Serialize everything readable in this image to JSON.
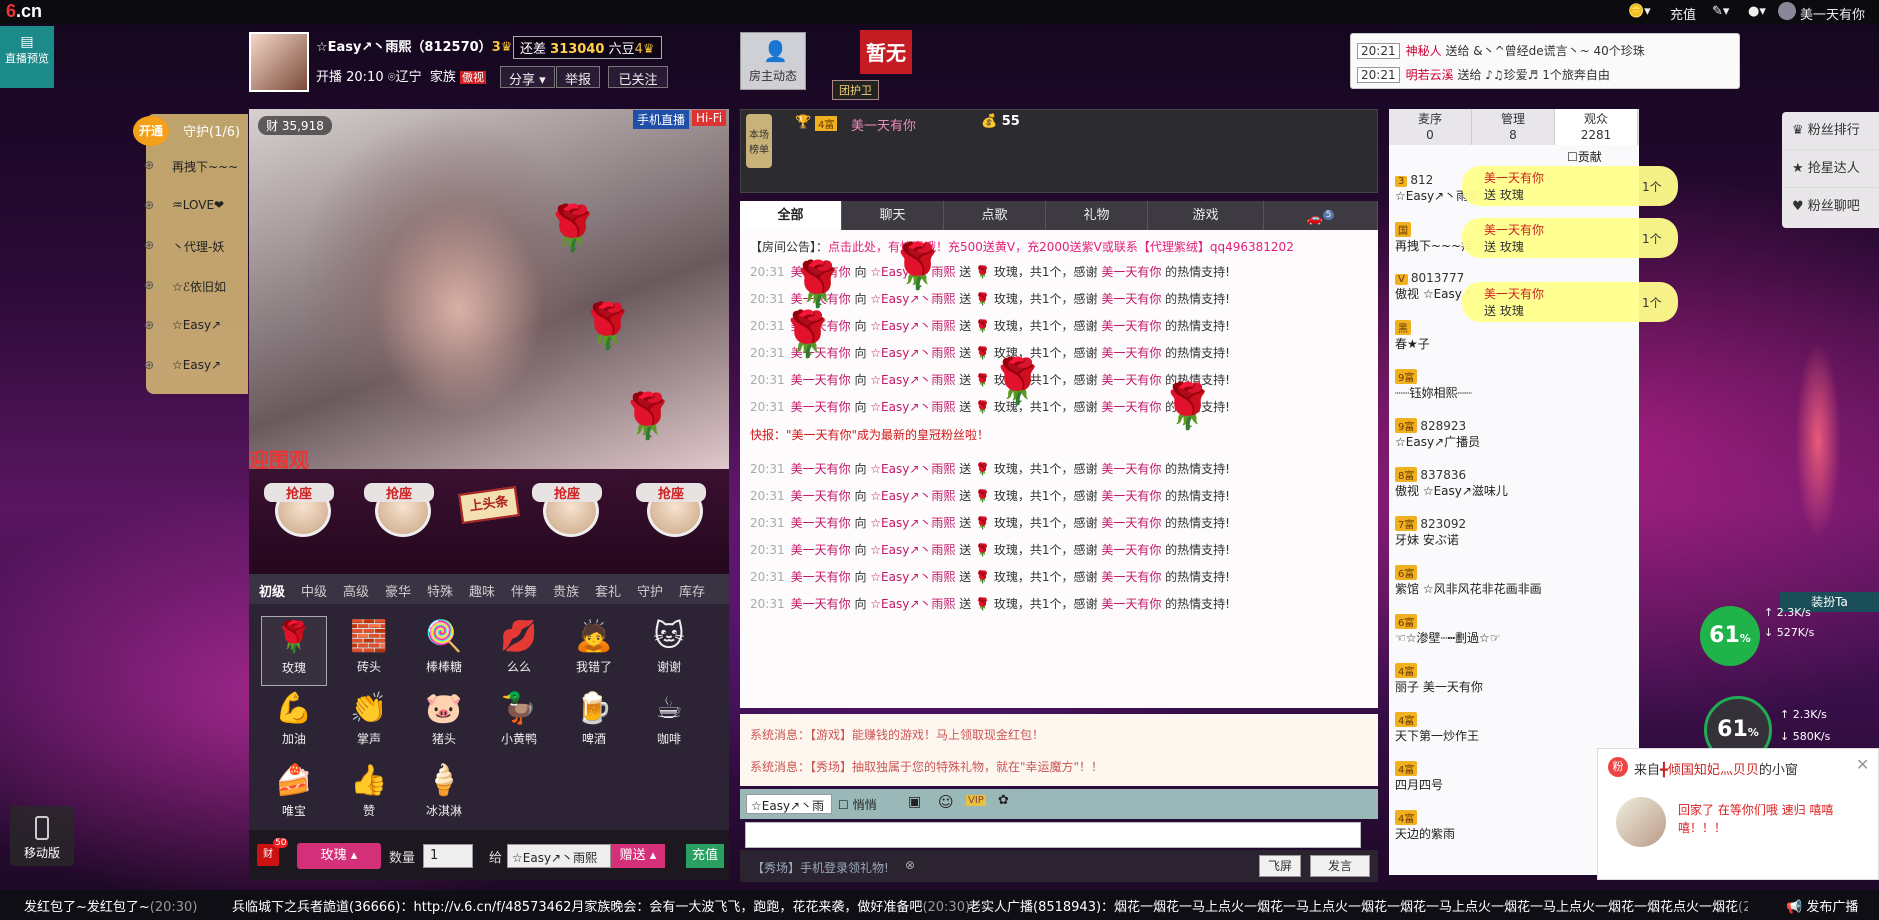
{
  "topbar": {
    "logo": "6.cn",
    "recharge": "充值",
    "username": "美一天有你"
  },
  "preview": {
    "label": "直播预览"
  },
  "host": {
    "name": "☆Easy↗丶雨熙（812570）",
    "level": "3",
    "beans_prefix": "还差",
    "beans": "313040",
    "beans_suffix": "六豆",
    "beans_level": "4",
    "open_time": "开播 20:10",
    "location": "辽宁",
    "family_label": "家族",
    "family": "傲视",
    "share": "分享",
    "report": "举报",
    "followed": "已关注"
  },
  "dynamics": {
    "label": "房主动态"
  },
  "guard_top": {
    "none": "暂无",
    "guard": "团护卫"
  },
  "ticker": [
    {
      "time": "20:21",
      "user": "神秘人",
      "text": "送给 &丶^曾经de谎言丶~ 40个珍珠"
    },
    {
      "time": "20:21",
      "user": "明若云溪",
      "text": "送给 ♪♫珍爱♬ 1个旅奔自由"
    }
  ],
  "guard_panel": {
    "open": "开通",
    "title": "守护(1/6)",
    "members": [
      "再拽下~~~",
      "♒LOVE❤",
      "丶代理-妖",
      "☆ℰ依旧如",
      "☆Easy↗",
      "☆Easy↗"
    ]
  },
  "video": {
    "viewers": "35,918",
    "mobile": "手机直播",
    "hifi": "Hi-Fi",
    "welcome": "迎围观"
  },
  "seats": {
    "grab": "抢座",
    "headline": "上头条"
  },
  "gift_tabs": [
    "初级",
    "中级",
    "高级",
    "豪华",
    "特殊",
    "趣味",
    "伴舞",
    "贵族",
    "套礼",
    "守护",
    "库存"
  ],
  "gifts": [
    {
      "name": "玫瑰",
      "icon": "🌹"
    },
    {
      "name": "砖头",
      "icon": "🧱"
    },
    {
      "name": "棒棒糖",
      "icon": "🍭"
    },
    {
      "name": "么么",
      "icon": "💋"
    },
    {
      "name": "我错了",
      "icon": "🙇"
    },
    {
      "name": "谢谢",
      "icon": "🐱"
    },
    {
      "name": "加油",
      "icon": "💪"
    },
    {
      "name": "掌声",
      "icon": "👏"
    },
    {
      "name": "猪头",
      "icon": "🐷"
    },
    {
      "name": "小黄鸭",
      "icon": "🦆"
    },
    {
      "name": "啤酒",
      "icon": "🍺"
    },
    {
      "name": "咖啡",
      "icon": "☕"
    },
    {
      "name": "唯宝",
      "icon": "🍰"
    },
    {
      "name": "赞",
      "icon": "👍"
    },
    {
      "name": "冰淇淋",
      "icon": "🍦"
    }
  ],
  "send": {
    "count_badge": "50",
    "gift": "玫瑰",
    "qty_label": "数量",
    "qty": "1",
    "to_label": "给",
    "to": "☆Easy↗丶雨熙",
    "give": "赠送",
    "recharge": "充值"
  },
  "rank": {
    "label": "本场榜单",
    "level": "4富",
    "user": "美一天有你",
    "score": "55"
  },
  "chat_tabs": [
    "全部",
    "聊天",
    "点歌",
    "礼物",
    "游戏"
  ],
  "chat_tab_badge": "5",
  "chat": {
    "notice_prefix": "【房间公告】：",
    "notice": "点击此处，有惊喜哦！充500送黄V，充2000送紫V或联系【代理紫绒】qq496381202",
    "line": {
      "time": "20:31",
      "from": "美一天有你",
      "mid": "向",
      "to": "☆Easy↗丶雨熙",
      "send": "送",
      "gift": "玫瑰，共1个，感谢",
      "thanks_user": "美一天有你",
      "end": "的热情支持!"
    },
    "alert": "快报：\"美一天有你\"成为最新的皇冠粉丝啦！"
  },
  "system": [
    "系统消息：【游戏】能赚钱的游戏！马上领取现金红包！",
    "系统消息：【秀场】抽取独属于您的特殊礼物，就在\"幸运魔方\"！！"
  ],
  "input": {
    "target": "☆Easy↗丶雨",
    "whisper": "悄悄",
    "promo": "【秀场】手机登录领礼物!",
    "fly": "飞屏",
    "send": "发言"
  },
  "ulist_tabs": [
    {
      "label": "麦序",
      "count": "0"
    },
    {
      "label": "管理",
      "count": "8"
    },
    {
      "label": "观众",
      "count": "2281"
    }
  ],
  "contrib": "贡献",
  "users": [
    {
      "lv": "3",
      "name": "☆Easy↗丶雨熙",
      "id": "812"
    },
    {
      "lv": "国",
      "name": "再拽下~~~痒",
      "id": ""
    },
    {
      "lv": "V",
      "name": "傲视 ☆Easy↗",
      "id": "8013777"
    },
    {
      "lv": "黑",
      "name": "春★子",
      "id": ""
    },
    {
      "lv": "9富",
      "name": "┈┈钰妳相熙┈┈",
      "id": ""
    },
    {
      "lv": "9富",
      "name": "☆Easy↗广播员",
      "id": "828923"
    },
    {
      "lv": "8富",
      "name": "傲视 ☆Easy↗滋味儿",
      "id": "837836"
    },
    {
      "lv": "7富",
      "name": "牙妹 安ぶ诺",
      "id": "823092"
    },
    {
      "lv": "6富",
      "name": "紫馆 ☆风非风花非花画非画",
      "id": ""
    },
    {
      "lv": "6富",
      "name": "☜☆渗壁┄┅劃過☆☞",
      "id": ""
    },
    {
      "lv": "4富",
      "name": "丽子 美一天有你",
      "id": ""
    },
    {
      "lv": "4富",
      "name": "天下第一炒作王",
      "id": ""
    },
    {
      "lv": "4富",
      "name": "四月四号",
      "id": ""
    },
    {
      "lv": "4富",
      "name": "天边的紫雨",
      "id": ""
    }
  ],
  "float_notices": [
    {
      "user": "美一天有你",
      "text": "送 玫瑰",
      "count": "1个"
    },
    {
      "user": "美一天有你",
      "text": "送 玫瑰",
      "count": "1个"
    },
    {
      "user": "美一天有你",
      "text": "送 玫瑰",
      "count": "1个"
    }
  ],
  "right_menu": [
    "粉丝排行",
    "抢星达人",
    "粉丝聊吧"
  ],
  "dressup": "装扮Ta",
  "net": [
    {
      "pct": "61",
      "unit": "%",
      "up": "2.3K/s",
      "down": "527K/s"
    },
    {
      "pct": "61",
      "unit": "%",
      "up": "2.3K/s",
      "down": "580K/s"
    }
  ],
  "popup": {
    "from_prefix": "来自",
    "from": "╋倾国知妃灬贝贝",
    "from_suffix": "的小窗",
    "msg": "回家了 在等你们哦 速归 嘻嘻嘻！！！"
  },
  "mobile": "移动版",
  "bottom": {
    "left": "发红包了~发红包了~",
    "left_time": "(20:30)",
    "mid": "兵临城下之兵者詭道(36666)：http://v.6.cn/f/48573462月家族晚会：会有一大波飞飞，跑跑，花花来袭，做好准备吧",
    "mid_time": "(20:30)",
    "right": "老实人广播(8518943)：烟花一烟花一马上点火一烟花一马上点火一烟花一烟花一马上点火一烟花一马上点火一烟花一烟花点火一烟花",
    "right_time": "(20:30)",
    "publish": "发布广播"
  }
}
